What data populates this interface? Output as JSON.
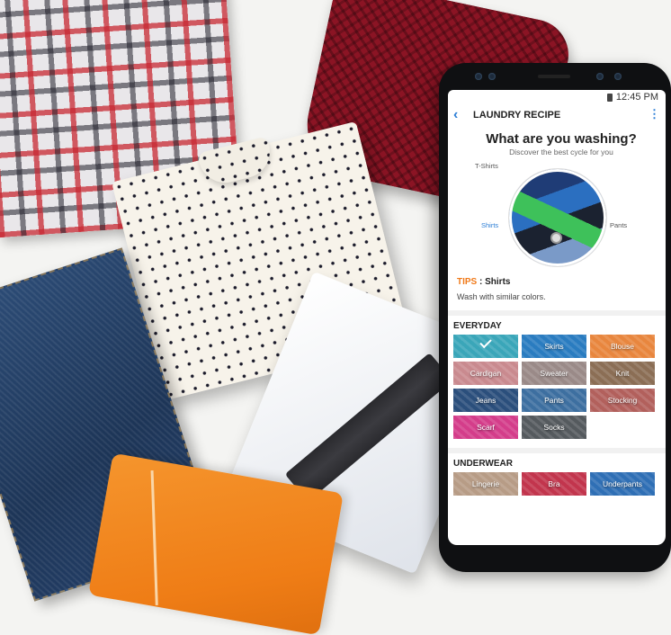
{
  "status_bar": {
    "time": "12:45 PM"
  },
  "app_bar": {
    "back_icon": "‹",
    "title": "LAUNDRY RECIPE",
    "more_icon": "⋮"
  },
  "intro": {
    "headline": "What are you washing?",
    "subline": "Discover the best cycle for you"
  },
  "dial": {
    "labels": {
      "top": "T-Shirts",
      "left": "Shirts",
      "right": "Pants"
    },
    "selected": "Shirts"
  },
  "tips": {
    "key": "TIPS",
    "separator": " : ",
    "item": "Shirts",
    "text": "Wash with similar colors."
  },
  "sections": {
    "everyday": {
      "title": "EVERYDAY",
      "tiles": [
        {
          "label": "",
          "color": "#3aa6b9",
          "checked": true
        },
        {
          "label": "Skirts",
          "color": "#2a7cc0"
        },
        {
          "label": "Blouse",
          "color": "#e8863e"
        },
        {
          "label": "Cardigan",
          "color": "#c98a8f"
        },
        {
          "label": "Sweater",
          "color": "#9a8a88"
        },
        {
          "label": "Knit",
          "color": "#8b6e55"
        },
        {
          "label": "Jeans",
          "color": "#2b4f7c"
        },
        {
          "label": "Pants",
          "color": "#3d6fa0"
        },
        {
          "label": "Stocking",
          "color": "#b2605c"
        },
        {
          "label": "Scarf",
          "color": "#d43d8a"
        },
        {
          "label": "Socks",
          "color": "#555a5e"
        }
      ]
    },
    "underwear": {
      "title": "UNDERWEAR",
      "tiles": [
        {
          "label": "Lingerie",
          "color": "#b79c86"
        },
        {
          "label": "Bra",
          "color": "#c2354d"
        },
        {
          "label": "Underpants",
          "color": "#2f6fb5"
        }
      ]
    }
  },
  "colors": {
    "accent": "#2c7ed6",
    "tips": "#f07a1a",
    "phone_body": "#0f1012"
  }
}
